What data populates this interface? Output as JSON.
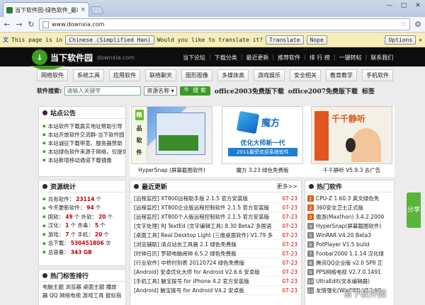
{
  "browser": {
    "tab_title": "当下软件园-绿色软件_最彩",
    "url": "www.downxia.com",
    "translate": {
      "prefix": "This page is in",
      "language": "Chinese (Simplified Han)",
      "question": "Would you like to translate it?",
      "translate_label": "Translate",
      "nope_label": "Nope",
      "options_label": "Options"
    }
  },
  "header": {
    "logo_text": "当下软件园",
    "logo_domain": "downxia.com",
    "topnav": [
      "当下论坛",
      "下载分类",
      "最近更新",
      "推荐软件",
      "排 行 榜",
      "一键转帖",
      "联系我们"
    ]
  },
  "categories": [
    "网络软件",
    "系统工具",
    "应用软件",
    "联络聊天",
    "图形图像",
    "多媒体类",
    "游戏娱乐",
    "安全相关",
    "教育教学",
    "手机软件"
  ],
  "search": {
    "label": "软件搜索:",
    "placeholder": "请输入关键字",
    "select": "资源名称",
    "button": "搜 索",
    "hot1": "office2003免费版下载",
    "hot2": "office2007免费版下载",
    "tags": "标签"
  },
  "notice": {
    "title": "站点公告",
    "items": [
      "本站软件下载真实地址帮助引导",
      "本站开放软件交流群-当下软件园",
      "本站诚征下载带宽、服务器赞助",
      "本站绿色软件来源于网络，仅提供",
      "本站新增移动通道下载镜像"
    ]
  },
  "stats": {
    "title": "资源统计",
    "rows": [
      {
        "label": "共有软件：",
        "value": "23114",
        "suffix": "个"
      },
      {
        "label": "今天更新软件：",
        "value": "94",
        "suffix": "个"
      },
      {
        "label": "国软：",
        "value": "49",
        "suffix": "个 外软：",
        "value2": "20",
        "suffix2": "个"
      },
      {
        "label": "汉化：",
        "value": "1",
        "suffix": "个 杀毒：",
        "value2": "5",
        "suffix2": "个"
      },
      {
        "label": "游戏：",
        "value": "7",
        "suffix": "个 手机：",
        "value2": "20",
        "suffix2": "个"
      },
      {
        "label": "总下载：",
        "value": "530451806",
        "suffix": "次"
      },
      {
        "label": "总容量：",
        "value": "343 GB",
        "suffix": ""
      }
    ]
  },
  "tags_box": {
    "title": "热门标签排行",
    "text": "电脑主题 浏览器 桌面主题 播放器 QQ 网络电视 游戏工具 鼠标指"
  },
  "featured": [
    {
      "badge": "精品软件",
      "caption": "HyperSnap (屏幕截图软件)"
    },
    {
      "logo": "魔方",
      "sub": "优化大师新一代",
      "sub2": "2011最受欢迎系统软件",
      "caption": "魔方 3.23 绿色免费版"
    },
    {
      "logo": "千千静听",
      "caption": "千千静听 V5.9.3 去广告"
    }
  ],
  "latest": {
    "title": "最近更新",
    "more": "更多>>",
    "rows": [
      {
        "name": "[远程监控] XT800远程助手版 2.1.5 官方安装版",
        "date": "07-23"
      },
      {
        "name": "[远程监控] XT800企业版远程控制软件 2.1.5 官方安装版",
        "date": "07-23"
      },
      {
        "name": "[远程监控] XT800个人版远程控制软件 2.1.5 官方安装版",
        "date": "07-23"
      },
      {
        "name": "[文字处理] RJ TextEd (文字编辑工具) 8.30 Beta2 多国语",
        "date": "07-23"
      },
      {
        "name": "[桌面工具] Real Desktop Light (三维桌面软件) V1.79 多",
        "date": "07-23"
      },
      {
        "name": "[浏览辅助] 清点站长工具箱 2.1 绿色免费版",
        "date": "07-23"
      },
      {
        "name": "[时钟日历] 罗顿电脑闹钟 6.5.2 绿色免费版",
        "date": "07-23"
      },
      {
        "name": "[行业软件] 中桥时刻表 20120724 绿色免费版",
        "date": "07-23"
      },
      {
        "name": "[Android] 安卓优化大师 for Android V2.6.6 安卓版",
        "date": "07-23"
      },
      {
        "name": "[手机工具] 触宝拨号 for iPhone 4.2 官方安装版",
        "date": "07-23"
      },
      {
        "name": "[Android] 触宝拨号 for Android V4.2 安卓版",
        "date": "07-23"
      }
    ]
  },
  "hot": {
    "title": "热门软件",
    "rows": [
      "CPU-Z 1.60.3 英文绿色免",
      "360安全卫士正式版",
      "傲游(Maxthon) 3.4.2.2000",
      "HyperSnap(屏幕截图软件)",
      "WinRAR V4.20 Beta3",
      "PotPlayer V1.5 build",
      "Foobar2000 1.1.14 汉化绿",
      "腾讯QQ企业版 v2.0 SP8 正",
      "PPS网络电视 V2.7.0.1491",
      "UltraEdit(文本编辑器)",
      "友情强化(WinFIM) V12.60"
    ]
  },
  "share": {
    "label": "分享"
  },
  "watermark": "当下软件园"
}
